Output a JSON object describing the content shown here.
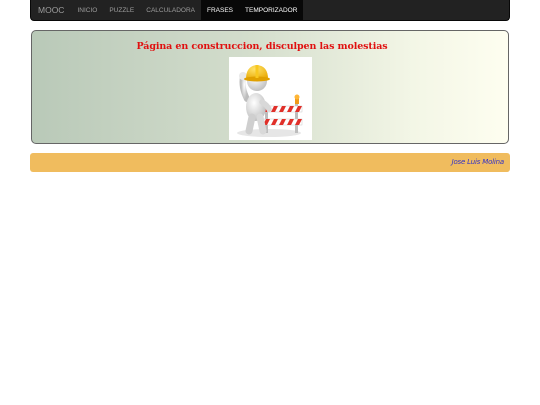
{
  "navbar": {
    "brand": "MOOC",
    "items": [
      {
        "label": "INICIO",
        "active": false
      },
      {
        "label": "PUZZLE",
        "active": false
      },
      {
        "label": "CALCULADORA",
        "active": false
      },
      {
        "label": "FRASES",
        "active": true
      },
      {
        "label": "TEMPORIZADOR",
        "active": true
      }
    ]
  },
  "construction": {
    "title": "Página en construccion, disculpen las molestias",
    "image_icon": "construction-worker-icon"
  },
  "footer": {
    "author": "Jose Luis Molina"
  },
  "colors": {
    "navbar_bg": "#222222",
    "footer_bg": "#f0bc5e",
    "title": "#e01010",
    "author": "#3030c8"
  }
}
